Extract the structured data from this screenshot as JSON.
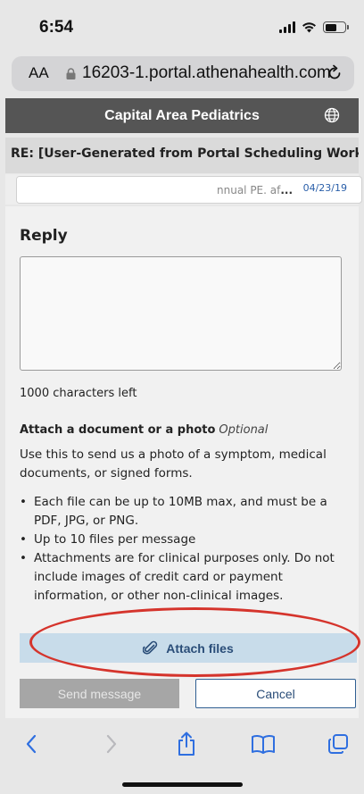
{
  "status": {
    "time": "6:54"
  },
  "browser": {
    "aa_label": "AA",
    "url": "16203-1.portal.athenahealth.com"
  },
  "header": {
    "title": "Capital Area Pediatrics"
  },
  "message": {
    "subject": "RE: [User-Generated from Portal Scheduling Workflow]",
    "preview": "nnual PE. af",
    "ellipsis": "...",
    "date": "04/23/19"
  },
  "reply": {
    "title": "Reply",
    "body_value": "",
    "chars_left": "1000 characters left"
  },
  "attach": {
    "heading": "Attach a document or a photo",
    "optional": "Optional",
    "description": "Use this to send us a photo of a symptom, medical documents, or signed forms.",
    "bullets": [
      "Each file can be up to 10MB max, and must be a PDF, JPG, or PNG.",
      "Up to 10 files per message",
      "Attachments are for clinical purposes only. Do not include images of credit card or payment information, or other non-clinical images."
    ],
    "button_label": "Attach files"
  },
  "actions": {
    "send_label": "Send message",
    "cancel_label": "Cancel"
  },
  "colors": {
    "header_bg": "#555555",
    "link_blue": "#2a4d78",
    "attach_button_bg": "#c8dcea",
    "annotation_red": "#d5342c",
    "toolbar_icon_blue": "#2f6fe0"
  },
  "toolbar": {
    "icons": [
      "back-icon",
      "forward-icon",
      "share-icon",
      "bookmarks-icon",
      "tabs-icon"
    ]
  }
}
